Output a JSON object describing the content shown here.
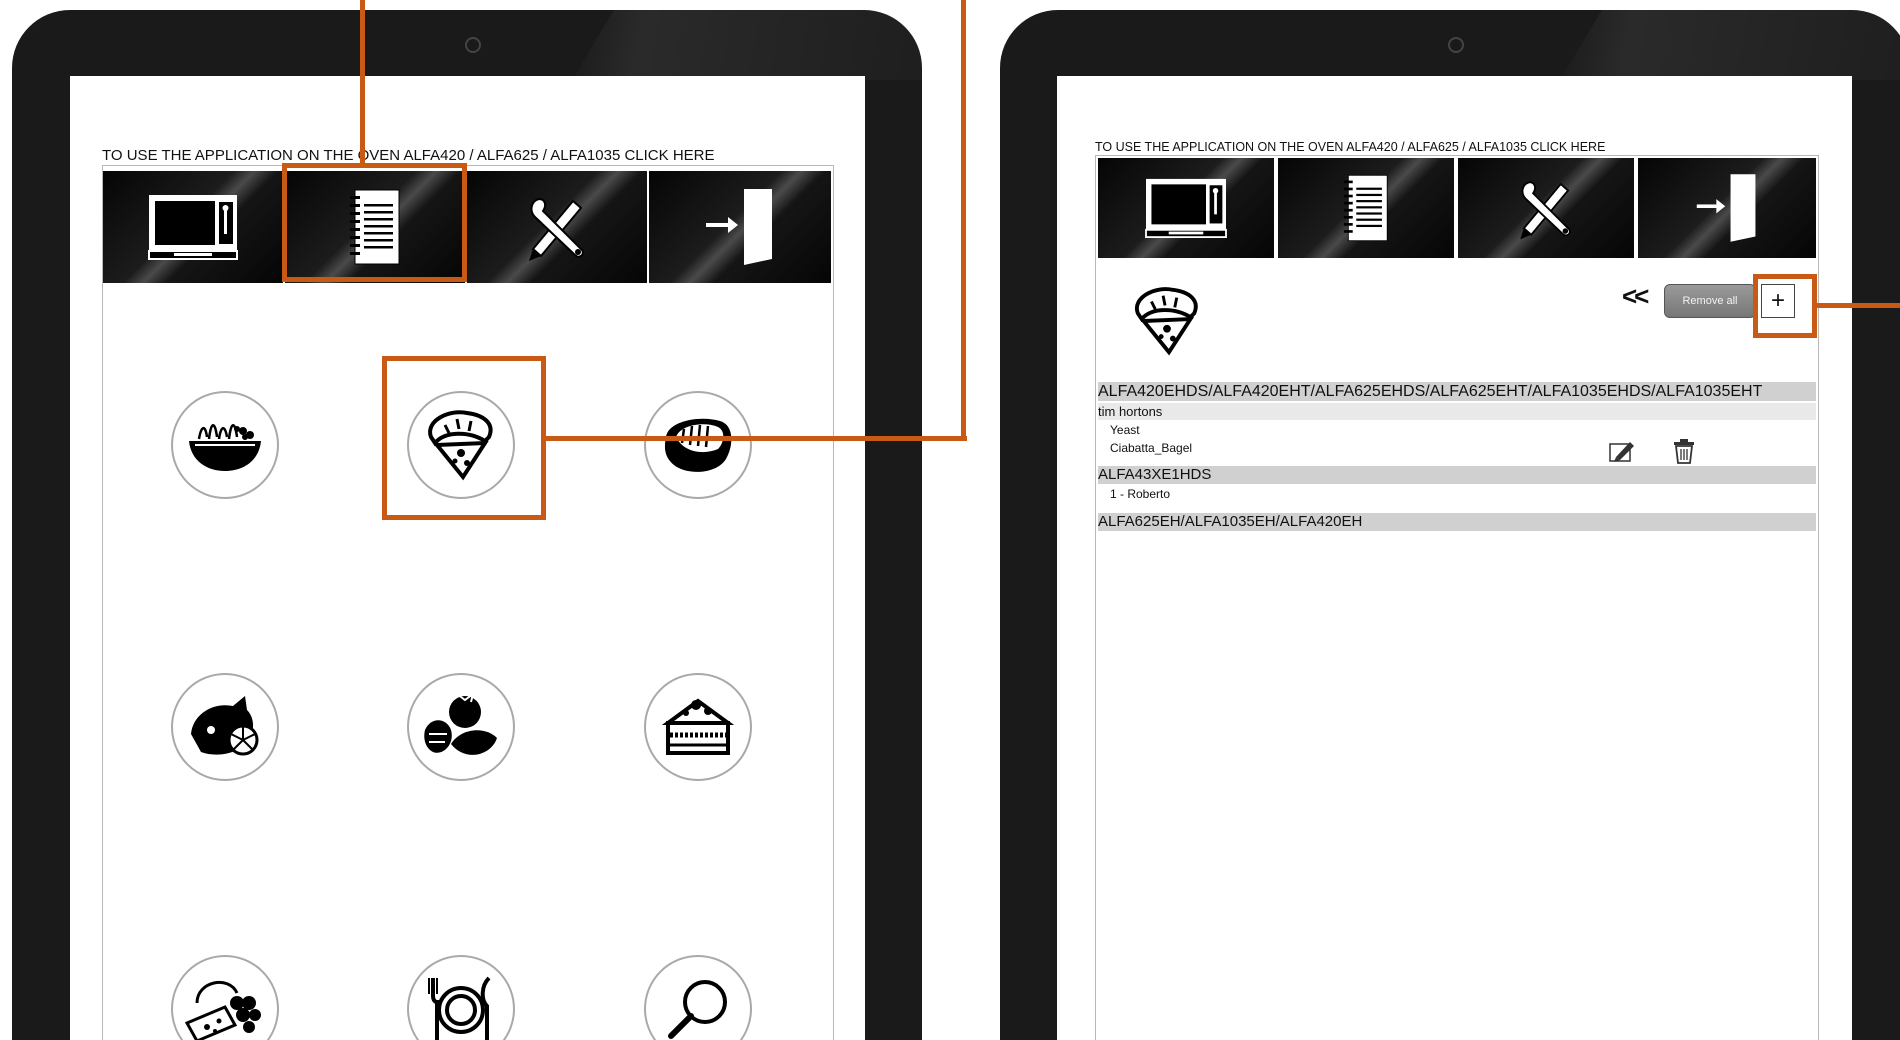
{
  "left_tablet": {
    "header_link": "TO USE THE APPLICATION ON THE OVEN ALFA420 / ALFA625 / ALFA1035 CLICK HERE",
    "menu": [
      {
        "icon": "oven-icon"
      },
      {
        "icon": "notebook-icon"
      },
      {
        "icon": "tools-icon"
      },
      {
        "icon": "logout-icon"
      }
    ],
    "categories": [
      {
        "icon": "pasta-bowl-icon"
      },
      {
        "icon": "pizza-bread-icon"
      },
      {
        "icon": "meat-steak-icon"
      },
      {
        "icon": "fish-lemon-icon"
      },
      {
        "icon": "vegetables-icon"
      },
      {
        "icon": "cake-slice-icon"
      },
      {
        "icon": "cheese-grapes-icon"
      },
      {
        "icon": "plate-cutlery-icon"
      },
      {
        "icon": "search-icon"
      }
    ]
  },
  "right_tablet": {
    "header_link": "TO USE THE APPLICATION ON THE OVEN ALFA420 / ALFA625 / ALFA1035 CLICK HERE",
    "back_label": "<<",
    "remove_all_label": "Remove all",
    "add_label": "+",
    "groups": [
      {
        "oven": "ALFA420EHDS/ALFA420EHT/ALFA625EHDS/ALFA625EHT/ALFA1035EHDS/ALFA1035EHT",
        "subgroup": "tim hortons",
        "recipes": [
          "Yeast",
          "Ciabatta_Bagel"
        ]
      },
      {
        "oven": "ALFA43XE1HDS",
        "recipes": [
          "1 - Roberto"
        ]
      },
      {
        "oven": "ALFA625EH/ALFA1035EH/ALFA420EH"
      }
    ]
  },
  "colors": {
    "highlight": "#c85a13",
    "bezel": "#1a1a1a",
    "row_gray": "#d0d0d0",
    "row_light": "#e9e9e9"
  }
}
